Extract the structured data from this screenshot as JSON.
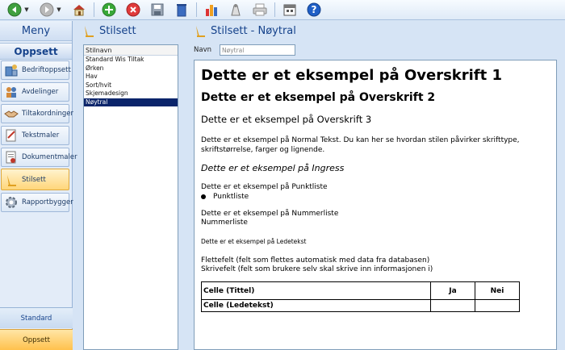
{
  "toolbar": {
    "buttons": [
      "back-icon",
      "forward-icon",
      "home-icon",
      "add-icon",
      "delete-icon",
      "save-icon",
      "trash-icon",
      "chart-icon",
      "clean-icon",
      "print-icon",
      "calendar-icon",
      "help-icon"
    ]
  },
  "menu": {
    "title": "Meny",
    "group": "Oppsett",
    "items": [
      {
        "label": "Bedriftoppsett",
        "icon": "company-icon"
      },
      {
        "label": "Avdelinger",
        "icon": "departments-icon"
      },
      {
        "label": "Tiltakordninger",
        "icon": "handshake-icon"
      },
      {
        "label": "Tekstmaler",
        "icon": "text-template-icon"
      },
      {
        "label": "Dokumentmaler",
        "icon": "document-template-icon"
      },
      {
        "label": "Stilsett",
        "icon": "style-icon"
      },
      {
        "label": "Rapportbygger",
        "icon": "gear-icon"
      }
    ],
    "selected": "Stilsett",
    "bottom_tabs": [
      "Standard",
      "Oppsett"
    ]
  },
  "stylelist": {
    "title": "Stilsett",
    "column": "Stilnavn",
    "rows": [
      "Standard Wis Tiltak",
      "Ørken",
      "Hav",
      "Sort/hvit",
      "Skjemadesign",
      "Nøytral"
    ],
    "selected": "Nøytral"
  },
  "detail": {
    "title": "Stilsett - Nøytral",
    "name_label": "Navn",
    "name_value": "Nøytral",
    "preview": {
      "h1": "Dette er et eksempel på Overskrift 1",
      "h2": "Dette er et eksempel på Overskrift 2",
      "h3": "Dette er et eksempel på Overskrift 3",
      "normal": "Dette er et eksempel på Normal Tekst. Du kan her se hvordan stilen påvirker skrifttype, skriftstørrelse, farger og lignende.",
      "ingress": "Dette er et eksempel på Ingress",
      "bullet_intro": "Dette er et eksempel på Punktliste",
      "bullet_item": "Punktliste",
      "number_intro": "Dette er et eksempel på Nummerliste",
      "number_item": "Nummerliste",
      "lede": "Dette er et eksempel på Ledetekst",
      "merge_field": "Flettefelt (felt som flettes automatisk med data fra databasen)",
      "write_field": "Skrivefelt (felt som brukere selv skal skrive inn informasjonen i)",
      "table": {
        "title_cell": "Celle (Tittel)",
        "yes": "Ja",
        "no": "Nei",
        "lede_cell": "Celle (Ledetekst)"
      }
    }
  },
  "colors": {
    "accent": "#15428b",
    "selected_row": "#0a246a",
    "selected_tab": "#ffc14d"
  }
}
